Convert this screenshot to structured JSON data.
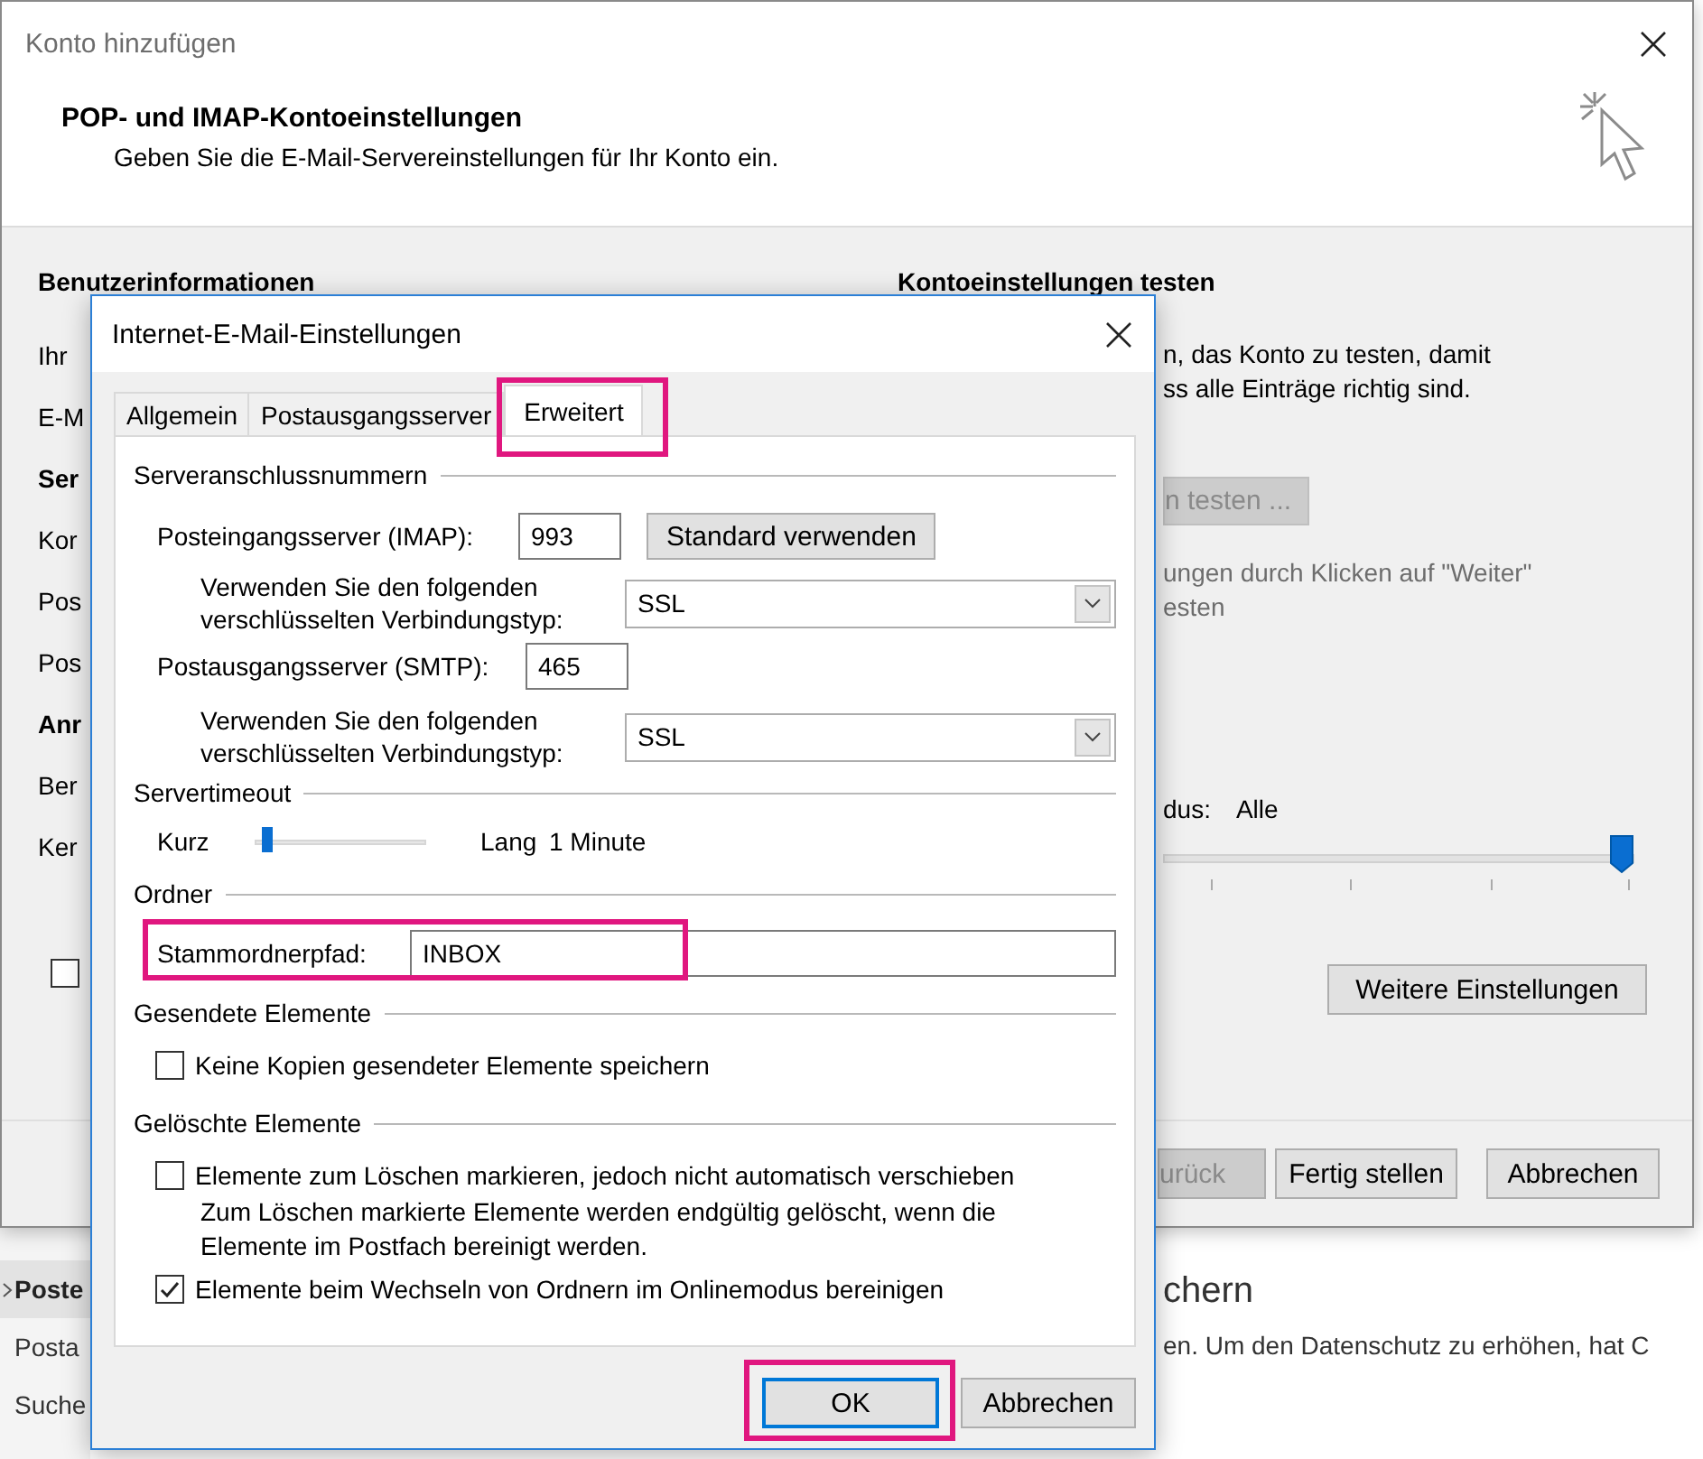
{
  "outlook": {
    "nav_items": [
      {
        "label": "Poste",
        "selected": true
      },
      {
        "label": "Posta",
        "selected": false
      },
      {
        "label": "Suche",
        "selected": false
      }
    ],
    "heading": "chern",
    "text": "en. Um den Datenschutz zu erhöhen, hat C"
  },
  "account_window": {
    "title": "Konto hinzufügen",
    "heading": "POP- und IMAP-Kontoeinstellungen",
    "subtitle": "Geben Sie die E-Mail-Servereinstellungen für Ihr Konto ein.",
    "left_items": [
      {
        "kind": "heading",
        "text": "Benutzerinformationen"
      },
      {
        "kind": "label",
        "text": "Ihr"
      },
      {
        "kind": "label",
        "text": "E-M"
      },
      {
        "kind": "heading",
        "text": "Ser"
      },
      {
        "kind": "label",
        "text": "Kor"
      },
      {
        "kind": "label",
        "text": "Pos"
      },
      {
        "kind": "label",
        "text": "Pos"
      },
      {
        "kind": "heading",
        "text": "Anr"
      },
      {
        "kind": "label",
        "text": "Ber"
      },
      {
        "kind": "label",
        "text": "Ker"
      }
    ],
    "left_checkbox": {
      "checked": false
    },
    "test_heading": "Kontoeinstellungen testen",
    "test_text": [
      "n, das Konto zu testen, damit",
      "ss alle Einträge richtig sind."
    ],
    "test_button": {
      "label": "n testen ...",
      "disabled": true
    },
    "auto_test_text": [
      "ungen durch Klicken auf \"Weiter\"",
      "esten"
    ],
    "mode_label": "dus:",
    "mode_value": "Alle",
    "mode_slider": {
      "level": 1
    },
    "more_button": "Weitere Einstellungen",
    "buttons": [
      {
        "label": "urück",
        "disabled": true
      },
      {
        "label": "Fertig stellen",
        "disabled": false
      },
      {
        "label": "Abbrechen",
        "disabled": false
      }
    ]
  },
  "dialog": {
    "title": "Internet-E-Mail-Einstellungen",
    "tabs": [
      {
        "label": "Allgemein",
        "selected": false,
        "highlighted": false
      },
      {
        "label": "Postausgangsserver",
        "selected": false,
        "highlighted": false
      },
      {
        "label": "Erweitert",
        "selected": true,
        "highlighted": true
      }
    ],
    "ports": {
      "title": "Serveranschlussnummern",
      "incoming_label": "Posteingangsserver (IMAP):",
      "incoming_port": "993",
      "default_button": "Standard verwenden",
      "incoming_encryption_label": "Verwenden Sie den folgenden verschlüsselten Verbindungstyp:",
      "incoming_encryption": "SSL",
      "outgoing_label": "Postausgangsserver (SMTP):",
      "outgoing_port": "465",
      "outgoing_encryption_label": "Verwenden Sie den folgenden verschlüsselten Verbindungstyp:",
      "outgoing_encryption": "SSL"
    },
    "timeout": {
      "title": "Servertimeout",
      "min_label": "Kurz",
      "max_label": "Lang",
      "level": 0.05,
      "value": "1 Minute"
    },
    "folders": {
      "title": "Ordner",
      "root_label": "Stammordnerpfad:",
      "root_value": "INBOX",
      "highlighted": true
    },
    "sent": {
      "title": "Gesendete Elemente",
      "options": [
        {
          "kind": "checkbox",
          "label": "Keine Kopien gesendeter Elemente speichern",
          "checked": false
        }
      ]
    },
    "deleted": {
      "title": "Gelöschte Elemente",
      "options": [
        {
          "kind": "checkbox",
          "label": "Elemente zum Löschen markieren, jedoch nicht automatisch verschieben",
          "checked": false
        },
        {
          "kind": "note",
          "text": "Zum Löschen markierte Elemente werden endgültig gelöscht, wenn die Elemente im Postfach bereinigt werden."
        },
        {
          "kind": "checkbox",
          "label": "Elemente beim Wechseln von Ordnern im Onlinemodus bereinigen",
          "checked": true
        }
      ]
    },
    "buttons": [
      {
        "label": "OK",
        "default": true,
        "highlighted": true
      },
      {
        "label": "Abbrechen",
        "default": false,
        "highlighted": false
      }
    ]
  }
}
